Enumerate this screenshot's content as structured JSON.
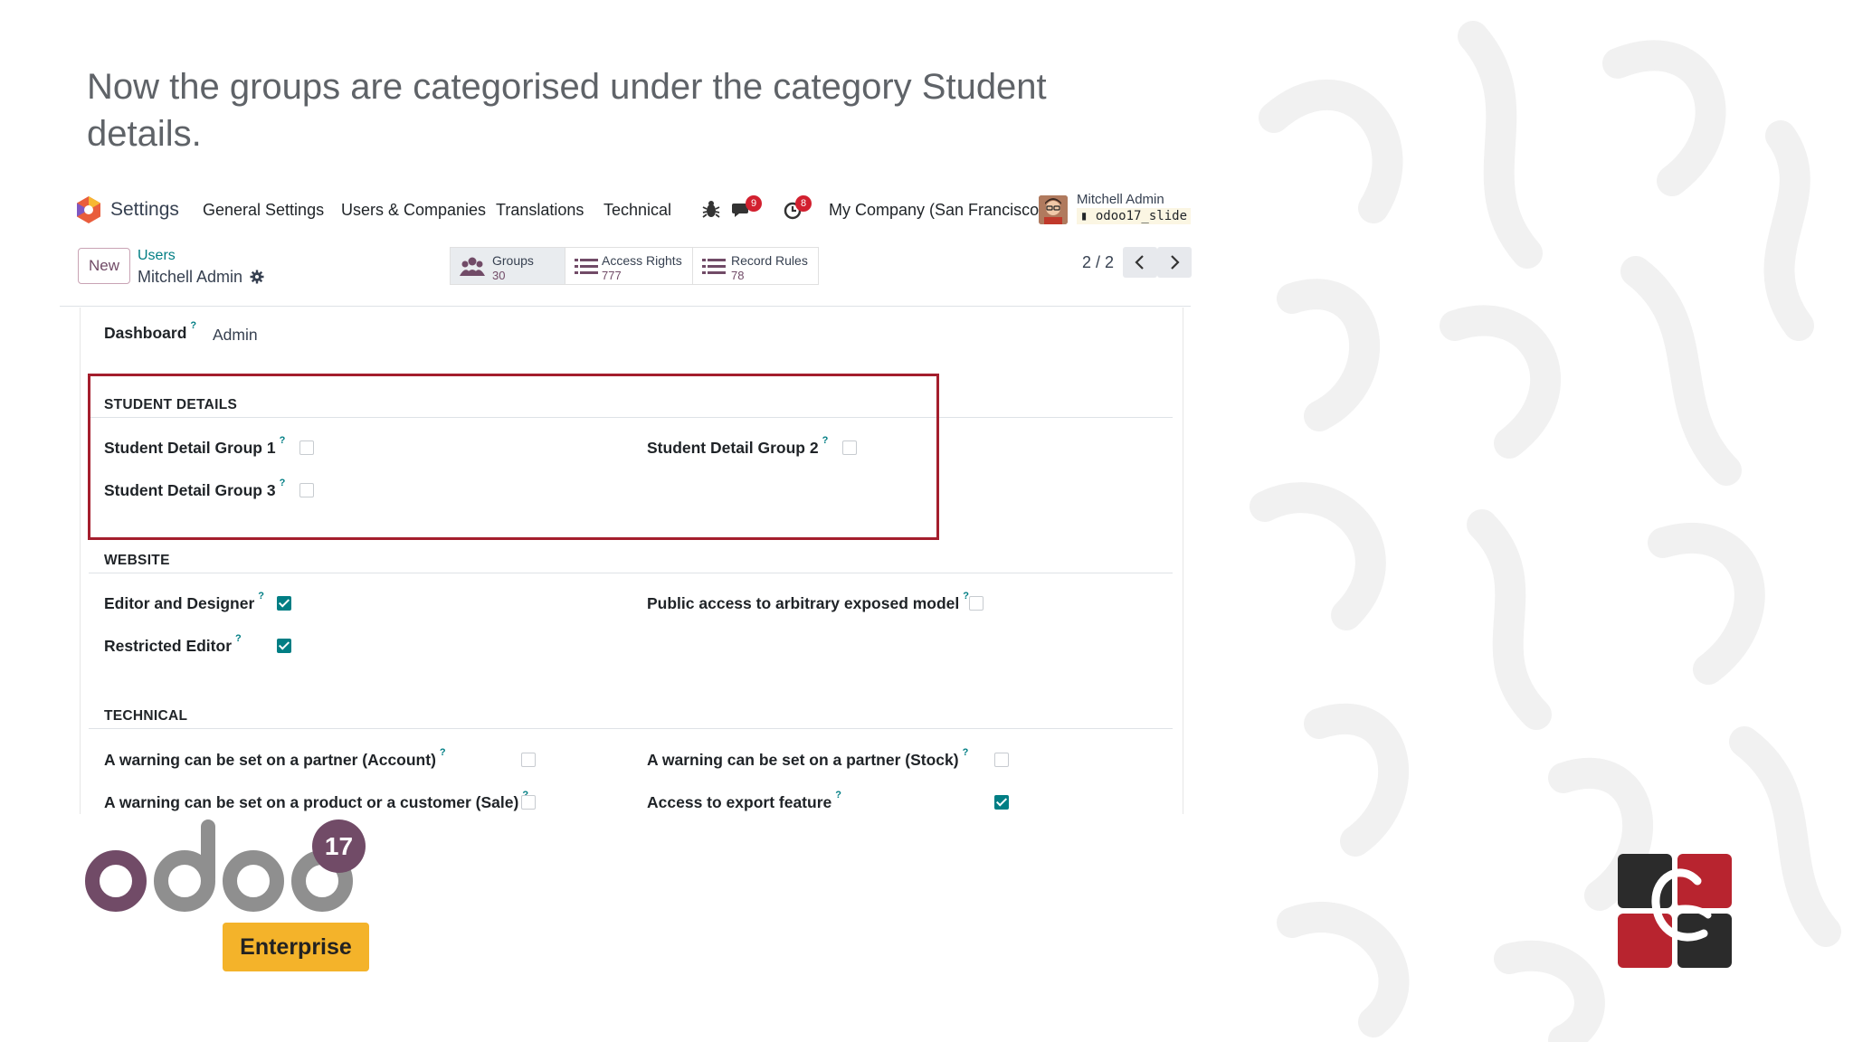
{
  "slide": {
    "title": "Now the groups are categorised under the category Student details."
  },
  "navbar": {
    "app_name": "Settings",
    "menu": [
      "General Settings",
      "Users & Companies",
      "Translations",
      "Technical"
    ],
    "icons": [
      "bug-icon",
      "chat-icon",
      "activity-clock-icon"
    ],
    "messages_count": "9",
    "activities_count": "8",
    "company": "My Company (San Francisco)",
    "user_name": "Mitchell Admin",
    "database": "odoo17_slide"
  },
  "control_panel": {
    "new_label": "New",
    "breadcrumb_parent": "Users",
    "breadcrumb_current": "Mitchell Admin",
    "smart_buttons": [
      {
        "label": "Groups",
        "count": "30"
      },
      {
        "label": "Access Rights",
        "count": "777"
      },
      {
        "label": "Record Rules",
        "count": "78"
      }
    ],
    "pager": "2 / 2"
  },
  "form": {
    "dashboard_label": "Dashboard",
    "dashboard_value": "Admin",
    "help_mark": "?",
    "student_details": {
      "title": "STUDENT DETAILS",
      "group1": {
        "label": "Student Detail Group 1",
        "checked": false
      },
      "group2": {
        "label": "Student Detail Group 2",
        "checked": false
      },
      "group3": {
        "label": "Student Detail Group 3",
        "checked": false
      }
    },
    "website": {
      "title": "WEBSITE",
      "editor_designer": {
        "label": "Editor and Designer",
        "checked": true
      },
      "public_access": {
        "label": "Public access to arbitrary exposed model",
        "checked": false
      },
      "restricted_editor": {
        "label": "Restricted Editor",
        "checked": true
      }
    },
    "technical": {
      "title": "TECHNICAL",
      "warning_account": {
        "label": "A warning can be set on a partner (Account)",
        "checked": false
      },
      "warning_stock": {
        "label": "A warning can be set on a partner (Stock)",
        "checked": false
      },
      "warning_sale": {
        "label": "A warning can be set on a product or a customer (Sale)",
        "checked": false
      },
      "export_feature": {
        "label": "Access to export feature",
        "checked": true
      }
    }
  },
  "branding": {
    "odoo_version": "17",
    "edition": "Enterprise"
  },
  "colors": {
    "accent_purple": "#714b67",
    "teal": "#017e84",
    "highlight_red": "#a41e2d",
    "enterprise_yellow": "#f4b32a"
  }
}
